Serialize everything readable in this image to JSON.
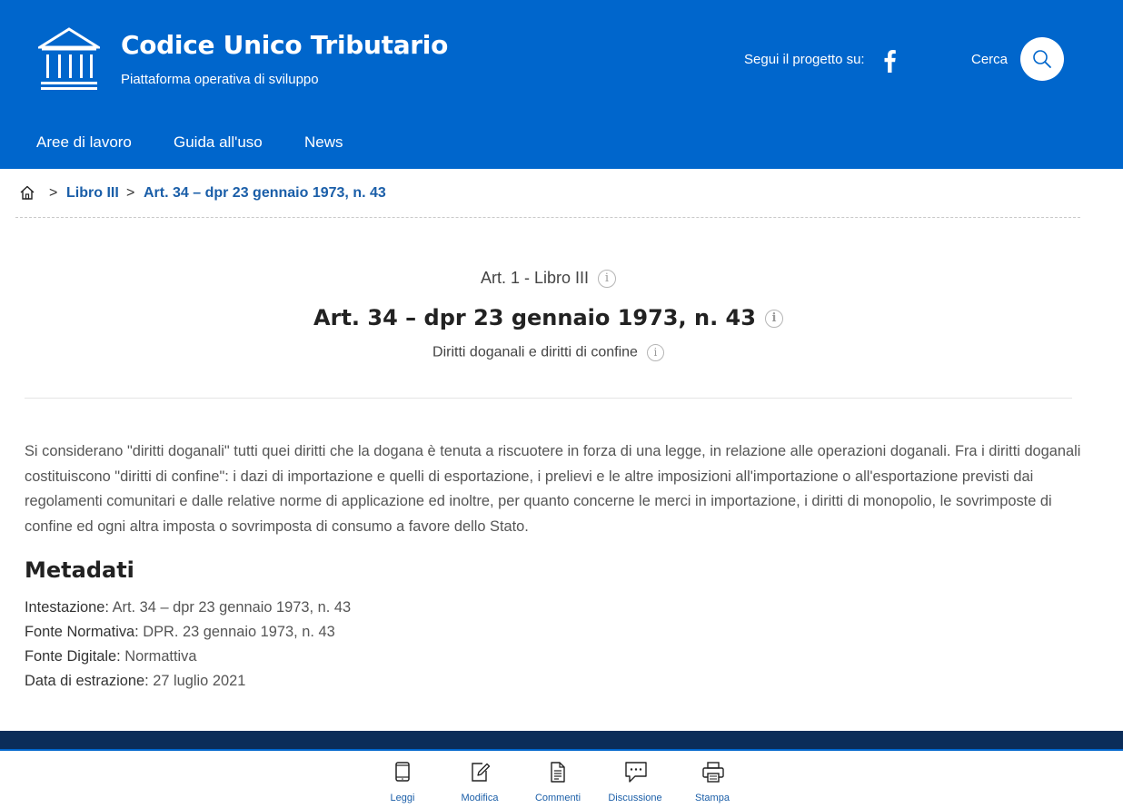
{
  "header": {
    "site_title": "Codice Unico Tributario",
    "site_subtitle": "Piattaforma operativa di sviluppo",
    "follow_label": "Segui il progetto su:",
    "search_label": "Cerca",
    "logo_icon": "building-columns-icon",
    "social_icon": "facebook-icon",
    "search_icon": "search-icon"
  },
  "nav": {
    "items": [
      "Aree di lavoro",
      "Guida all'uso",
      "News"
    ]
  },
  "breadcrumb": {
    "home_icon": "home-icon",
    "separator": ">",
    "items": [
      "Libro III",
      "Art. 34 – dpr 23 gennaio 1973, n. 43"
    ]
  },
  "article": {
    "pre_title": "Art. 1 - Libro III",
    "title": "Art. 34 – dpr 23 gennaio 1973, n. 43",
    "subtitle": "Diritti doganali e diritti di confine",
    "info_icon_text": "i",
    "body": "Si considerano \"diritti doganali\" tutti quei diritti che la dogana è tenuta a riscuotere in forza di una legge, in relazione alle operazioni doganali. Fra i diritti doganali costituiscono \"diritti di confine\": i dazi di importazione e quelli di esportazione, i prelievi e le altre imposizioni all'importazione o all'esportazione previsti dai regolamenti comunitari e dalle relative norme di applicazione ed inoltre, per quanto concerne le merci in importazione, i diritti di monopolio, le sovrimposte di confine ed ogni altra imposta o sovrimposta di consumo a favore dello Stato."
  },
  "metadata": {
    "title": "Metadati",
    "rows": [
      {
        "key": "Intestazione:",
        "value": "Art. 34 – dpr 23 gennaio 1973, n. 43"
      },
      {
        "key": "Fonte Normativa:",
        "value": "DPR. 23 gennaio 1973, n. 43"
      },
      {
        "key": "Fonte Digitale:",
        "value": "Normattiva"
      },
      {
        "key": "Data di estrazione:",
        "value": "27 luglio 2021"
      }
    ]
  },
  "toolbar": {
    "items": [
      {
        "label": "Leggi",
        "icon": "tablet-icon"
      },
      {
        "label": "Modifica",
        "icon": "edit-icon"
      },
      {
        "label": "Commenti",
        "icon": "document-icon"
      },
      {
        "label": "Discussione",
        "icon": "chat-icon"
      },
      {
        "label": "Stampa",
        "icon": "printer-icon"
      }
    ]
  },
  "colors": {
    "header_bg": "#0066cc",
    "footer_band": "#0b2d59",
    "link": "#1a5ea8"
  }
}
